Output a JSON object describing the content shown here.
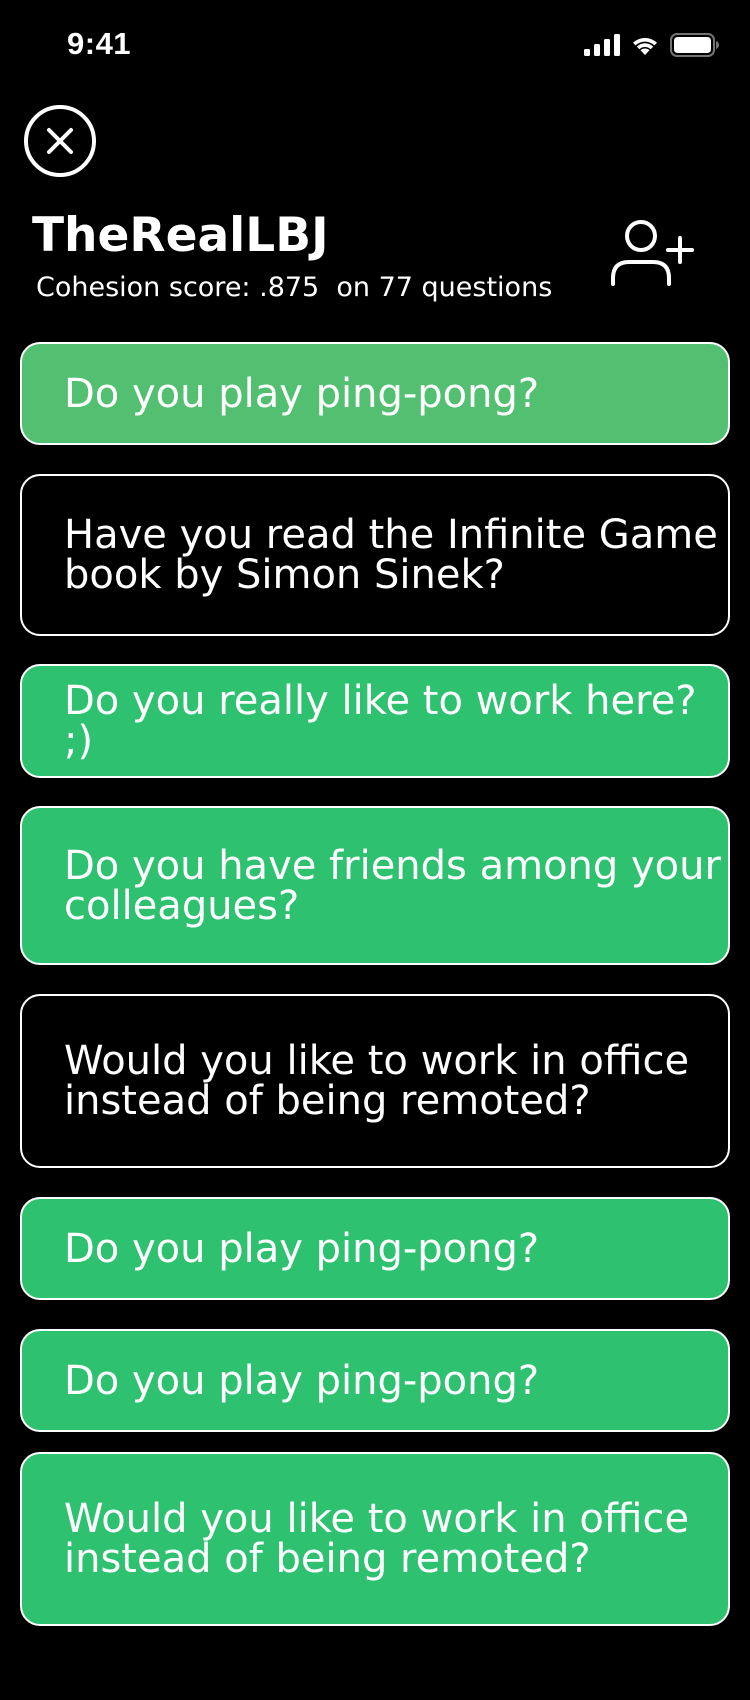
{
  "status_bar": {
    "time": "9:41"
  },
  "header": {
    "username": "TheRealLBJ",
    "cohesion_text": "Cohesion score: .875  on 77 questions"
  },
  "questions": [
    {
      "text": "Do you play ping-pong?",
      "state": "answered-light"
    },
    {
      "text": "Have you read the Infinite Game book by Simon Sinek?",
      "state": "unanswered"
    },
    {
      "text": "Do you really like to work here? ;)",
      "state": "answered"
    },
    {
      "text": "Do you have friends among your colleagues?",
      "state": "answered"
    },
    {
      "text": "Would you like to work in office instead of being remoted?",
      "state": "unanswered"
    },
    {
      "text": "Do you play ping-pong?",
      "state": "answered"
    },
    {
      "text": "Do you play ping-pong?",
      "state": "answered"
    },
    {
      "text": "Would you like to work in office instead of being remoted?",
      "state": "answered"
    }
  ],
  "colors": {
    "background": "#000000",
    "answered": "#2ec16f",
    "answered_light": "#53c071",
    "border": "#ffffff"
  },
  "icons": {
    "close": "close-icon",
    "add_user": "add-user-icon",
    "signal": "cellular-signal-icon",
    "wifi": "wifi-icon",
    "battery": "battery-icon"
  }
}
